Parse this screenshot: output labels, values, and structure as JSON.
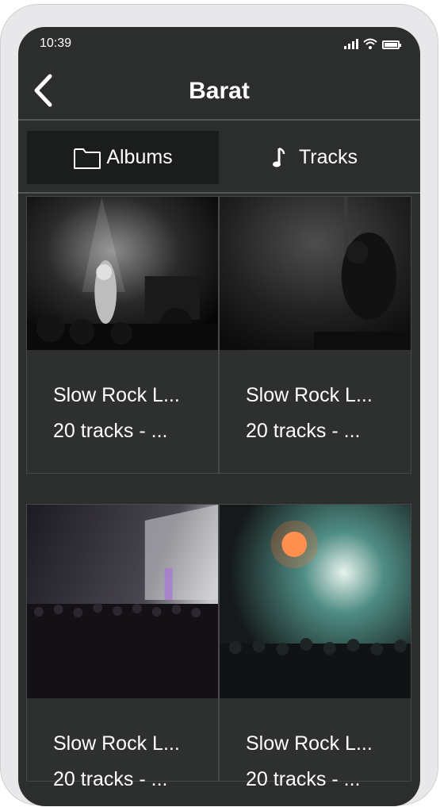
{
  "status_bar": {
    "time": "10:39",
    "icons": [
      "signal-icon",
      "wifi-icon",
      "battery-icon"
    ],
    "battery_level": 1.0
  },
  "header": {
    "title": "Barat",
    "back_icon": "chevron-left-icon"
  },
  "tabs": [
    {
      "label": "Albums",
      "icon": "folder-icon",
      "selected": true
    },
    {
      "label": "Tracks",
      "icon": "music-note-icon",
      "selected": false
    }
  ],
  "albums": [
    {
      "title": "Slow Rock L...",
      "meta": "20 tracks - ..."
    },
    {
      "title": "Slow Rock L...",
      "meta": "20 tracks - ..."
    },
    {
      "title": "Slow Rock L...",
      "meta": "20 tracks - ..."
    },
    {
      "title": "Slow Rock L...",
      "meta": "20 tracks - ..."
    }
  ],
  "colors": {
    "screen_bg": "#2c2d2d",
    "selected_tab_bg": "#1b1c1c",
    "text": "#ffffff",
    "divider": "#555757"
  }
}
